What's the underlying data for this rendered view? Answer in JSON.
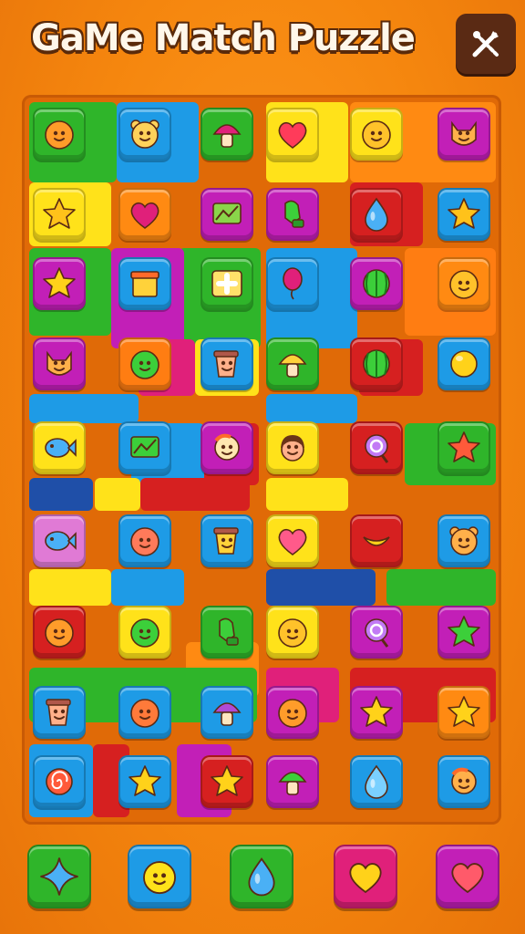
{
  "header": {
    "title": "GaMe Match Puzzle",
    "settings_icon": "tools-icon"
  },
  "board": {
    "patches": [
      {
        "c": "#2fb52a"
      },
      {
        "c": "#1e9be6"
      },
      {
        "c": "#ffe21a"
      },
      {
        "c": "#ff8a12"
      },
      {
        "c": "#ffe21a"
      },
      {
        "c": "#d62020"
      },
      {
        "c": "#2fb52a"
      },
      {
        "c": "#1e9be6"
      },
      {
        "c": "#2fb52a"
      },
      {
        "c": "#ff7d12"
      },
      {
        "c": "#c21fb7"
      },
      {
        "c": "#1e9be6"
      },
      {
        "c": "#e0207a"
      },
      {
        "c": "#ffe21a"
      },
      {
        "c": "#1e9be6"
      },
      {
        "c": "#d62020"
      },
      {
        "c": "#1e9be6"
      },
      {
        "c": "#d62020"
      },
      {
        "c": "#2fb52a"
      },
      {
        "c": "#1f4fa8"
      },
      {
        "c": "#ffe21a"
      },
      {
        "c": "#d62020"
      },
      {
        "c": "#ffe21a"
      },
      {
        "c": "#ffe21a"
      },
      {
        "c": "#1e9be6"
      },
      {
        "c": "#c21fb7"
      },
      {
        "c": "#1f4fa8"
      },
      {
        "c": "#2fb52a"
      },
      {
        "c": "#ff8a12"
      },
      {
        "c": "#2fb52a"
      },
      {
        "c": "#e0207a"
      },
      {
        "c": "#d62020"
      },
      {
        "c": "#1e9be6"
      },
      {
        "c": "#d62020"
      },
      {
        "c": "#c21fb7"
      }
    ],
    "tiles": [
      {
        "icon": "smiley-icon",
        "bg": "#2fb52a",
        "fg": "#ff9c2a"
      },
      {
        "icon": "bear-icon",
        "bg": "#1e9be6",
        "fg": "#ffd25a"
      },
      {
        "icon": "mushroom-icon",
        "bg": "#2fb52a",
        "fg": "#e0207a"
      },
      {
        "icon": "heart-icon",
        "bg": "#ffe21a",
        "fg": "#ff3b5a"
      },
      {
        "icon": "smiley-icon",
        "bg": "#ffe21a",
        "fg": "#ffc22a"
      },
      {
        "icon": "cat-icon",
        "bg": "#c21fb7",
        "fg": "#ffb04a"
      },
      {
        "icon": "star-icon",
        "bg": "#ffe21a",
        "fg": "#ffc21a"
      },
      {
        "icon": "heart-icon",
        "bg": "#ff8a12",
        "fg": "#e0207a"
      },
      {
        "icon": "flag-icon",
        "bg": "#c21fb7",
        "fg": "#8ad54a"
      },
      {
        "icon": "mitten-icon",
        "bg": "#c21fb7",
        "fg": "#3ccf3a"
      },
      {
        "icon": "drop-icon",
        "bg": "#d62020",
        "fg": "#4ab0f5"
      },
      {
        "icon": "star-icon",
        "bg": "#1e9be6",
        "fg": "#ffc21a"
      },
      {
        "icon": "star-icon",
        "bg": "#c21fb7",
        "fg": "#ffd21a"
      },
      {
        "icon": "box-icon",
        "bg": "#1e9be6",
        "fg": "#ffd23a"
      },
      {
        "icon": "plus-icon",
        "bg": "#2fb52a",
        "fg": "#ffe16a"
      },
      {
        "icon": "balloon-icon",
        "bg": "#1e9be6",
        "fg": "#e0207a"
      },
      {
        "icon": "melon-icon",
        "bg": "#c21fb7",
        "fg": "#3ccf3a"
      },
      {
        "icon": "smiley-icon",
        "bg": "#ff8a12",
        "fg": "#ffc22a"
      },
      {
        "icon": "cat-icon",
        "bg": "#c21fb7",
        "fg": "#ffb04a"
      },
      {
        "icon": "smiley-icon",
        "bg": "#ff7d12",
        "fg": "#3ccf3a"
      },
      {
        "icon": "cup-icon",
        "bg": "#1e9be6",
        "fg": "#ffb08a"
      },
      {
        "icon": "mushroom-icon",
        "bg": "#2fb52a",
        "fg": "#ffd23a"
      },
      {
        "icon": "melon-icon",
        "bg": "#d62020",
        "fg": "#3ccf3a"
      },
      {
        "icon": "circle-icon",
        "bg": "#1e9be6",
        "fg": "#ffd21a"
      },
      {
        "icon": "fish-icon",
        "bg": "#ffe21a",
        "fg": "#4ab0f5"
      },
      {
        "icon": "flag-icon",
        "bg": "#1e9be6",
        "fg": "#3ccf3a"
      },
      {
        "icon": "bird-icon",
        "bg": "#c21fb7",
        "fg": "#ffe6b0"
      },
      {
        "icon": "face-icon",
        "bg": "#ffe21a",
        "fg": "#ffb08a"
      },
      {
        "icon": "lollipop-icon",
        "bg": "#d62020",
        "fg": "#c27af5"
      },
      {
        "icon": "star-icon",
        "bg": "#2fb52a",
        "fg": "#ff5a3a"
      },
      {
        "icon": "fish-icon",
        "bg": "#e07ad5",
        "fg": "#4ab0f5"
      },
      {
        "icon": "smiley-icon",
        "bg": "#1e9be6",
        "fg": "#ff7a5a"
      },
      {
        "icon": "cup-icon",
        "bg": "#1e9be6",
        "fg": "#ffd23a"
      },
      {
        "icon": "heart-icon",
        "bg": "#ffe21a",
        "fg": "#ff5a8a"
      },
      {
        "icon": "banana-icon",
        "bg": "#d62020",
        "fg": "#ffd21a"
      },
      {
        "icon": "bear-icon",
        "bg": "#1e9be6",
        "fg": "#ffb04a"
      },
      {
        "icon": "smiley-icon",
        "bg": "#d62020",
        "fg": "#ff9c2a"
      },
      {
        "icon": "smiley-icon",
        "bg": "#ffe21a",
        "fg": "#3ccf3a"
      },
      {
        "icon": "mitten-icon",
        "bg": "#2fb52a",
        "fg": "#3ccf3a"
      },
      {
        "icon": "smiley-icon",
        "bg": "#ffe21a",
        "fg": "#ffc22a"
      },
      {
        "icon": "lollipop-icon",
        "bg": "#c21fb7",
        "fg": "#c27af5"
      },
      {
        "icon": "star-icon",
        "bg": "#c21fb7",
        "fg": "#3ccf3a"
      },
      {
        "icon": "cup-icon",
        "bg": "#1e9be6",
        "fg": "#ffb08a"
      },
      {
        "icon": "smiley-icon",
        "bg": "#1e9be6",
        "fg": "#ff7a3a"
      },
      {
        "icon": "mushroom-icon",
        "bg": "#1e9be6",
        "fg": "#b04ad5"
      },
      {
        "icon": "smiley-icon",
        "bg": "#c21fb7",
        "fg": "#ff9c2a"
      },
      {
        "icon": "star-icon",
        "bg": "#c21fb7",
        "fg": "#ffd21a"
      },
      {
        "icon": "star-icon",
        "bg": "#ff8a12",
        "fg": "#ffd21a"
      },
      {
        "icon": "spiral-icon",
        "bg": "#1e9be6",
        "fg": "#ff5a3a"
      },
      {
        "icon": "star-icon",
        "bg": "#1e9be6",
        "fg": "#ffd21a"
      },
      {
        "icon": "star-icon",
        "bg": "#d62020",
        "fg": "#ffd21a"
      },
      {
        "icon": "mushroom-icon",
        "bg": "#c21fb7",
        "fg": "#3ccf3a"
      },
      {
        "icon": "drop-icon",
        "bg": "#1e9be6",
        "fg": "#7ad0ff"
      },
      {
        "icon": "bird-icon",
        "bg": "#1e9be6",
        "fg": "#ffb04a"
      }
    ]
  },
  "tray": [
    {
      "icon": "sparkle-icon",
      "bg": "#2fb52a",
      "fg": "#4ab0f5"
    },
    {
      "icon": "smiley-icon",
      "bg": "#1e9be6",
      "fg": "#ffe21a"
    },
    {
      "icon": "drop-icon",
      "bg": "#2fb52a",
      "fg": "#4ab0f5"
    },
    {
      "icon": "heart-icon",
      "bg": "#e0207a",
      "fg": "#ffd21a"
    },
    {
      "icon": "heart-icon",
      "bg": "#c21fb7",
      "fg": "#ff5a6a"
    }
  ]
}
